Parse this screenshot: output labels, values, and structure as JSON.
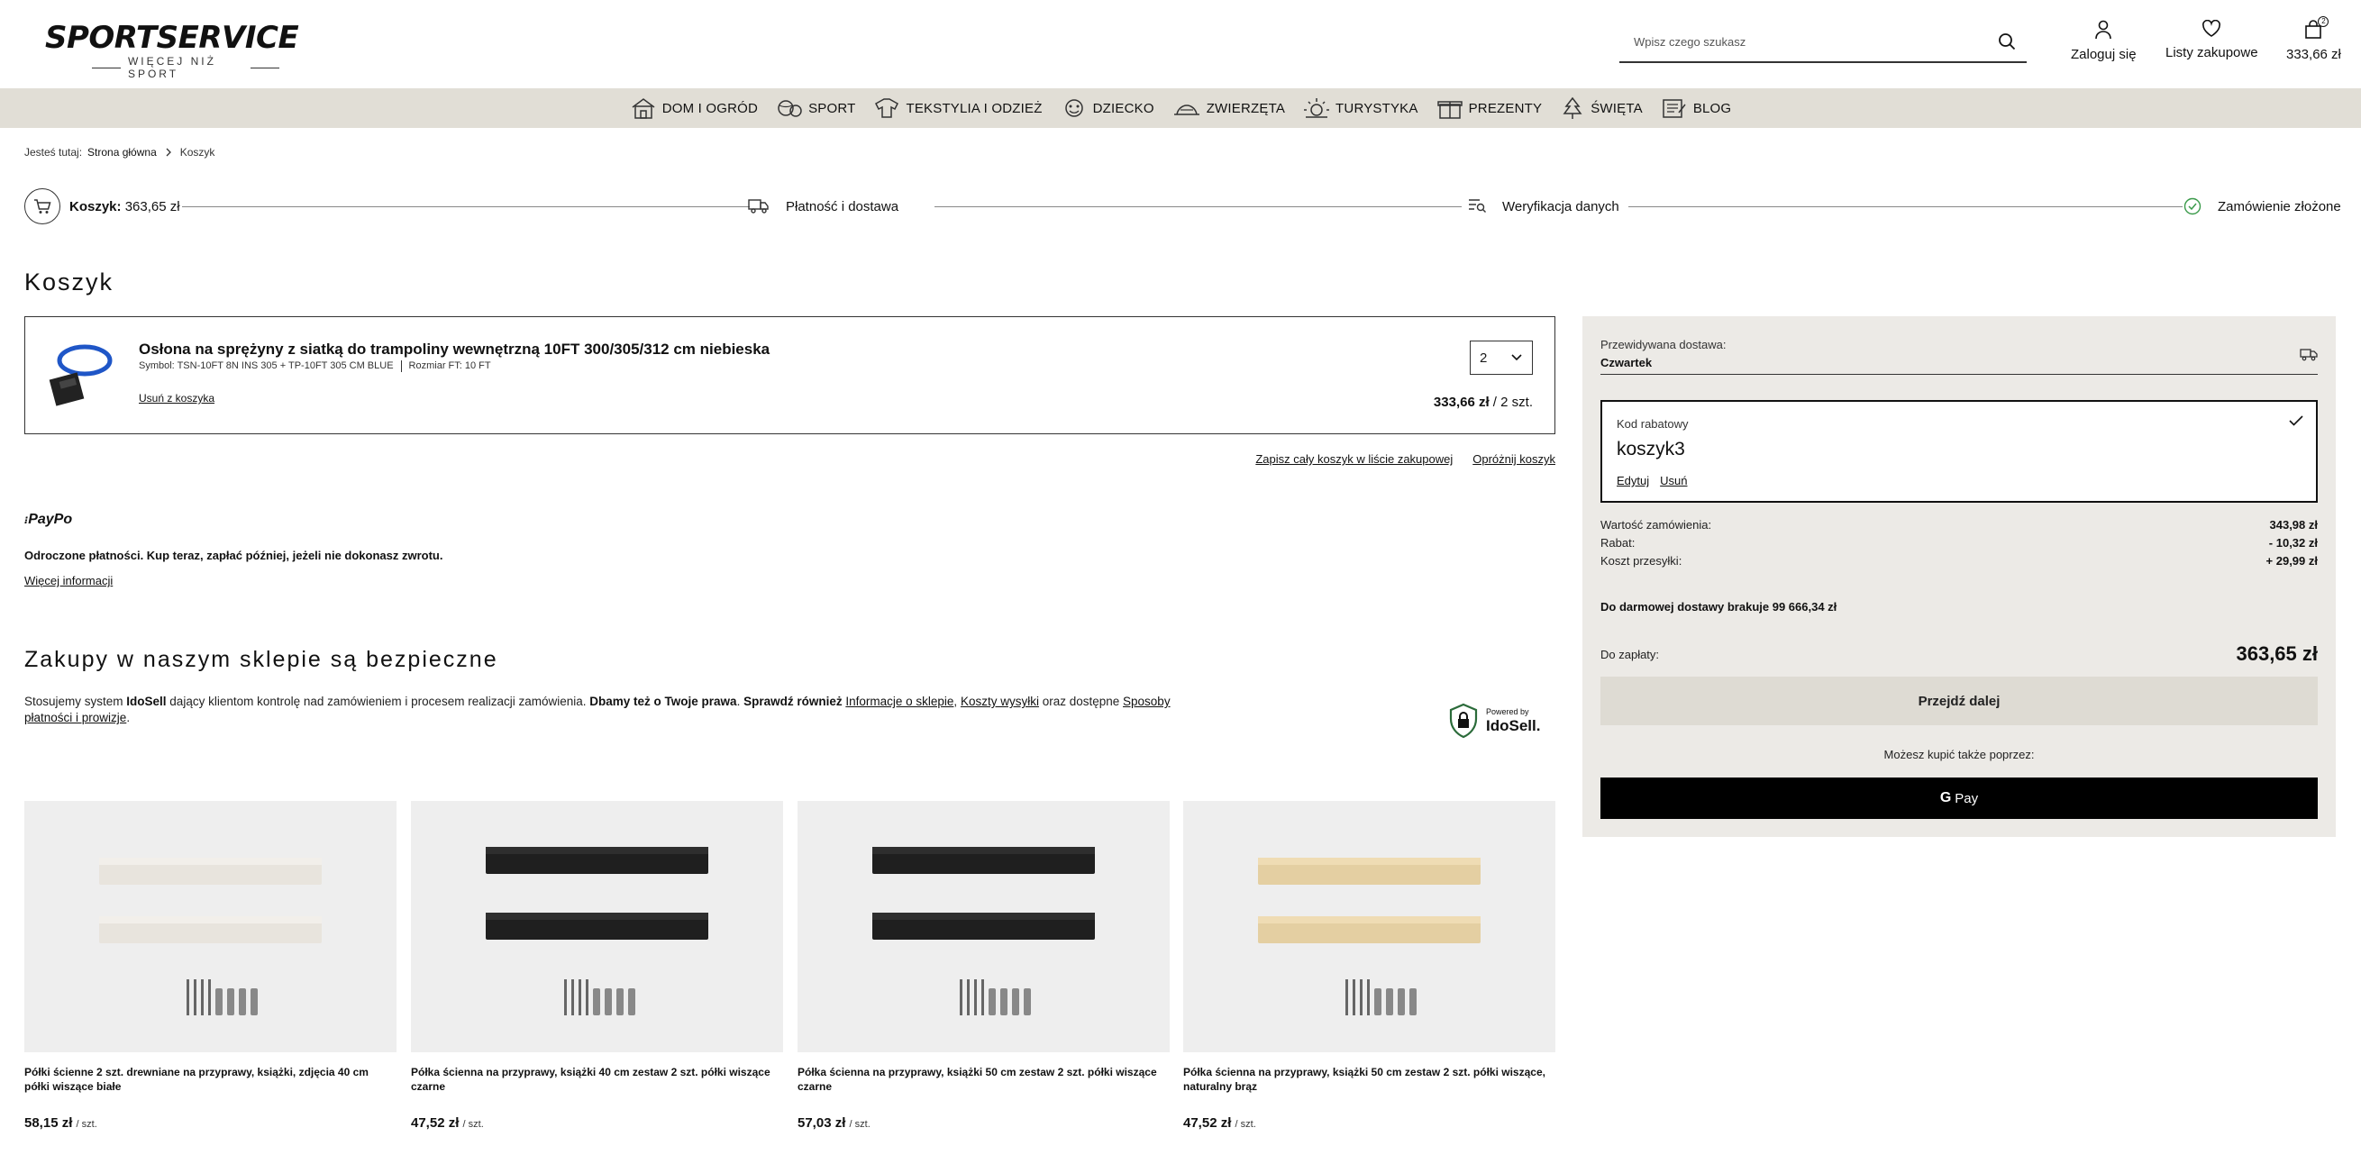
{
  "header": {
    "logo_main": "SPORTSERVICE",
    "logo_sub": "WIĘCEJ NIŻ SPORT",
    "search_placeholder": "Wpisz czego szukasz",
    "login": "Zaloguj się",
    "wishlist": "Listy zakupowe",
    "cart_total": "333,66 zł",
    "cart_count": "2"
  },
  "nav": [
    {
      "label": "DOM I OGRÓD",
      "icon": "house-icon"
    },
    {
      "label": "SPORT",
      "icon": "ball-icon"
    },
    {
      "label": "TEKSTYLIA I ODZIEŻ",
      "icon": "shirt-icon"
    },
    {
      "label": "DZIECKO",
      "icon": "toy-icon"
    },
    {
      "label": "ZWIERZĘTA",
      "icon": "pet-icon"
    },
    {
      "label": "TURYSTYKA",
      "icon": "sun-icon"
    },
    {
      "label": "PREZENTY",
      "icon": "gift-icon"
    },
    {
      "label": "ŚWIĘTA",
      "icon": "tree-icon"
    },
    {
      "label": "BLOG",
      "icon": "blog-icon"
    }
  ],
  "breadcrumb": {
    "prefix": "Jesteś tutaj:",
    "home": "Strona główna",
    "current": "Koszyk"
  },
  "steps": {
    "cart_label": "Koszyk:",
    "cart_value": "363,65 zł",
    "payment": "Płatność i dostawa",
    "verify": "Weryfikacja danych",
    "done": "Zamówienie złożone"
  },
  "page_title": "Koszyk",
  "cart_item": {
    "title": "Osłona na sprężyny z siatką do trampoliny wewnętrzną 10FT 300/305/312 cm niebieska",
    "symbol": "Symbol: TSN-10FT 8N INS 305 + TP-10FT 305 CM BLUE",
    "size": "Rozmiar FT: 10 FT",
    "remove": "Usuń z koszyka",
    "qty": "2",
    "price": "333,66 zł",
    "price_suffix": " / 2 szt."
  },
  "cart_actions": {
    "save": "Zapisz cały koszyk w liście zakupowej",
    "clear": "Opróżnij koszyk"
  },
  "paypo": {
    "logo": "PayPo",
    "text": "Odroczone płatności. Kup teraz, zapłać później, jeżeli nie dokonasz zwrotu.",
    "more": "Więcej informacji"
  },
  "safety": {
    "title": "Zakupy w naszym sklepie są bezpieczne",
    "t1": "Stosujemy system ",
    "t2": "IdoSell",
    "t3": " dający klientom kontrolę nad zamówieniem i procesem realizacji zamówienia. ",
    "t4": "Dbamy też o Twoje prawa",
    "t5": ". ",
    "t6": "Sprawdź również ",
    "t7": "Informacje o sklepie",
    "t8": ", ",
    "t9": "Koszty wysyłki",
    "t10": " oraz dostępne ",
    "t11": "Sposoby płatności i prowizje",
    "t12": ".",
    "powered": "Powered by",
    "brand": "IdoSell."
  },
  "products": [
    {
      "name": "Półki ścienne 2 szt. drewniane na przyprawy, książki, zdjęcia 40 cm półki wiszące białe",
      "price": "58,15 zł",
      "unit": "szt.",
      "color": "#e8e4dd",
      "lip": "#f2efea"
    },
    {
      "name": "Półka ścienna na przyprawy, książki 40 cm zestaw 2 szt. półki wiszące czarne",
      "price": "47,52 zł",
      "unit": "szt.",
      "color": "#1f1f1f",
      "lip": "#2e2e2e"
    },
    {
      "name": "Półka ścienna na przyprawy, książki 50 cm zestaw 2 szt. półki wiszące czarne",
      "price": "57,03 zł",
      "unit": "szt.",
      "color": "#1f1f1f",
      "lip": "#2e2e2e"
    },
    {
      "name": "Półka ścienna na przyprawy, książki 50 cm zestaw 2 szt. półki wiszące, naturalny brąz",
      "price": "47,52 zł",
      "unit": "szt.",
      "color": "#e4cfa2",
      "lip": "#efdcb4"
    }
  ],
  "summary": {
    "delivery_label": "Przewidywana dostawa:",
    "delivery_value": "Czwartek",
    "coupon_label": "Kod rabatowy",
    "coupon_code": "koszyk3",
    "coupon_edit": "Edytuj",
    "coupon_remove": "Usuń",
    "order_value_label": "Wartość zamówienia:",
    "order_value": "343,98 zł",
    "discount_label": "Rabat:",
    "discount": "- 10,32 zł",
    "shipping_label": "Koszt przesyłki:",
    "shipping": "+ 29,99 zł",
    "free_shipping": "Do darmowej dostawy brakuje 99 666,34 zł",
    "pay_label": "Do zapłaty:",
    "pay_value": "363,65 zł",
    "proceed": "Przejdź dalej",
    "also_buy": "Możesz kupić także poprzez:",
    "gpay_g": "G",
    "gpay": "Pay"
  }
}
